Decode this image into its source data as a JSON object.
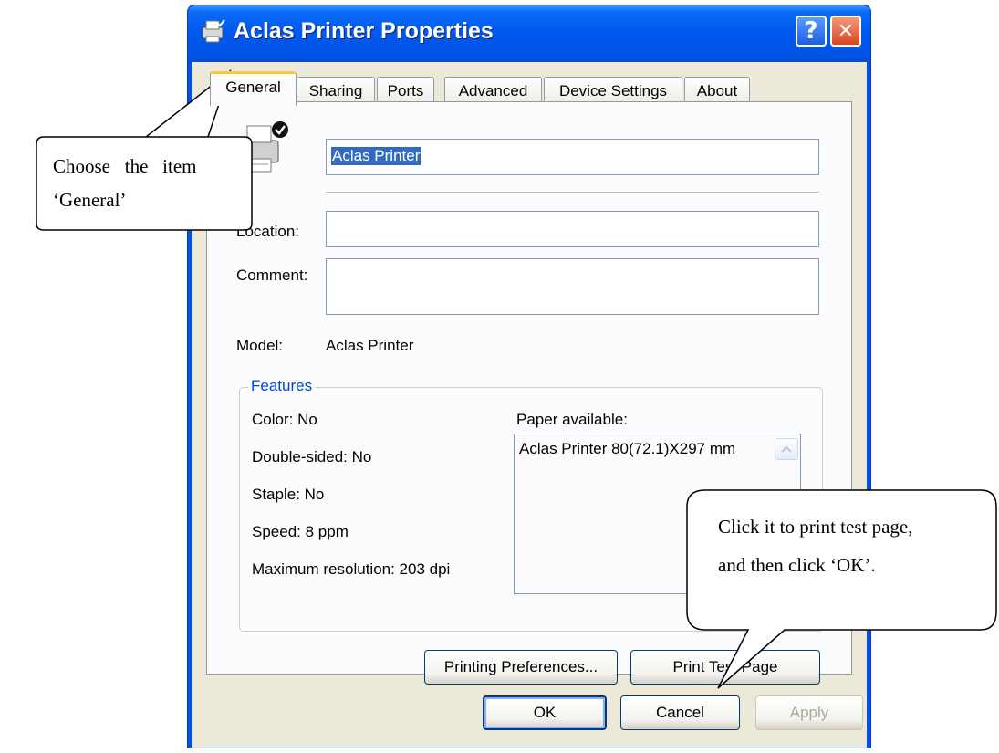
{
  "window": {
    "title": "Aclas Printer Properties",
    "help_glyph": "?",
    "close_glyph": "✕"
  },
  "tabs": [
    {
      "label": "General",
      "active": true
    },
    {
      "label": "Sharing",
      "active": false
    },
    {
      "label": "Ports",
      "active": false
    },
    {
      "label": "Advanced",
      "active": false
    },
    {
      "label": "Device Settings",
      "active": false
    },
    {
      "label": "About",
      "active": false
    }
  ],
  "general": {
    "printer_name": "Aclas Printer",
    "location_label": "Location:",
    "location_value": "",
    "comment_label": "Comment:",
    "comment_value": "",
    "model_label": "Model:",
    "model_value": "Aclas Printer"
  },
  "features": {
    "title": "Features",
    "color": "Color: No",
    "double_sided": "Double-sided: No",
    "staple": "Staple: No",
    "speed": "Speed: 8 ppm",
    "max_resolution": "Maximum resolution: 203 dpi",
    "paper_label": "Paper available:",
    "paper_items": [
      "Aclas Printer 80(72.1)X297 mm"
    ]
  },
  "buttons": {
    "printing_preferences": "Printing Preferences...",
    "print_test_page": "Print Test Page",
    "ok": "OK",
    "cancel": "Cancel",
    "apply": "Apply"
  },
  "callouts": {
    "general_line1": "Choose   the   item",
    "general_line2": "‘General’",
    "test_line1": "Click it to print test page,",
    "test_line2": "and then click ‘OK’."
  },
  "colors": {
    "titlebar": "#0054e3",
    "dialog_bg": "#ece9d8",
    "active_tab_highlight": "#ffc83c",
    "group_title": "#0046d5"
  }
}
